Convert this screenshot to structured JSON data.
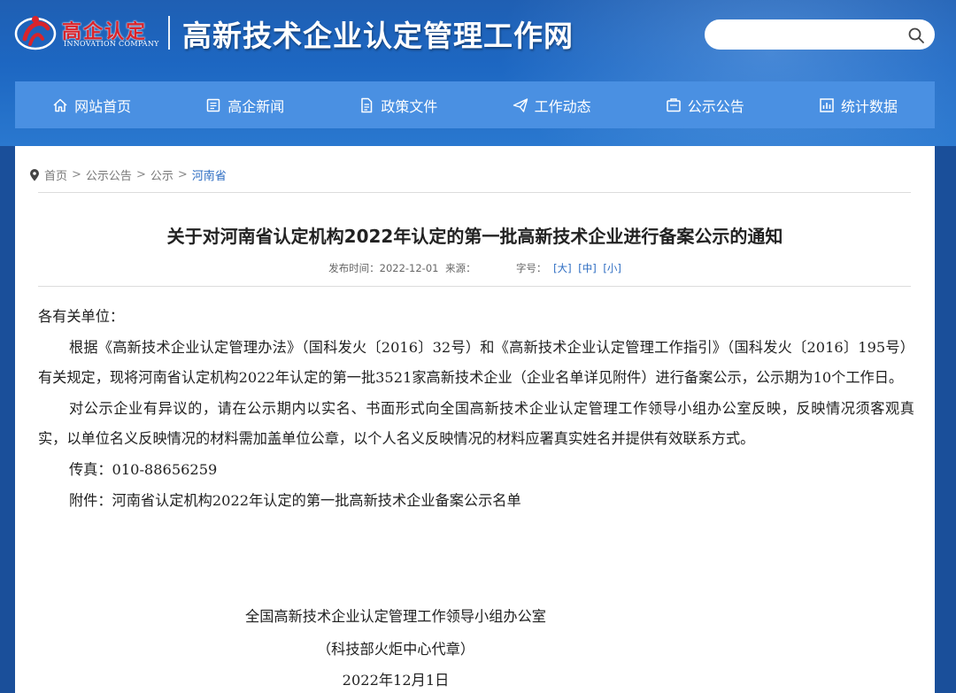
{
  "header": {
    "logo_cn": "高企认定",
    "logo_en": "INNOVATION COMPANY",
    "site_title": "高新技术企业认定管理工作网",
    "search_placeholder": ""
  },
  "nav": [
    {
      "label": "网站首页",
      "icon": "home-icon"
    },
    {
      "label": "高企新闻",
      "icon": "news-icon"
    },
    {
      "label": "政策文件",
      "icon": "document-icon"
    },
    {
      "label": "工作动态",
      "icon": "paper-plane-icon"
    },
    {
      "label": "公示公告",
      "icon": "notice-icon"
    },
    {
      "label": "统计数据",
      "icon": "chart-icon"
    }
  ],
  "breadcrumb": {
    "items": [
      "首页",
      "公示公告",
      "公示"
    ],
    "current": "河南省"
  },
  "article": {
    "title": "关于对河南省认定机构2022年认定的第一批高新技术企业进行备案公示的通知",
    "meta": {
      "publish_label": "发布时间：2022-12-01",
      "source_label": "来源：",
      "fontsize_label": "字号：",
      "size_large": "[大]",
      "size_medium": "[中]",
      "size_small": "[小]"
    },
    "salutation": "各有关单位：",
    "para1": "根据《高新技术企业认定管理办法》（国科发火〔2016〕32号）和《高新技术企业认定管理工作指引》（国科发火〔2016〕195号）有关规定，现将河南省认定机构2022年认定的第一批3521家高新技术企业（企业名单详见附件）进行备案公示，公示期为10个工作日。",
    "para2": "对公示企业有异议的，请在公示期内以实名、书面形式向全国高新技术企业认定管理工作领导小组办公室反映，反映情况须客观真实，以单位名义反映情况的材料需加盖单位公章，以个人名义反映情况的材料应署真实姓名并提供有效联系方式。",
    "fax": "传真：010-88656259",
    "attachment": "附件：河南省认定机构2022年认定的第一批高新技术企业备案公示名单",
    "signature_org": "全国高新技术企业认定管理工作领导小组办公室",
    "signature_sub": "（科技部火炬中心代章）",
    "signature_date": "2022年12月1日"
  },
  "colors": {
    "header_blue": "#1f5fb3",
    "nav_blue": "#4a90e2",
    "link_blue": "#2c6cc2",
    "logo_red": "#d9242b"
  }
}
